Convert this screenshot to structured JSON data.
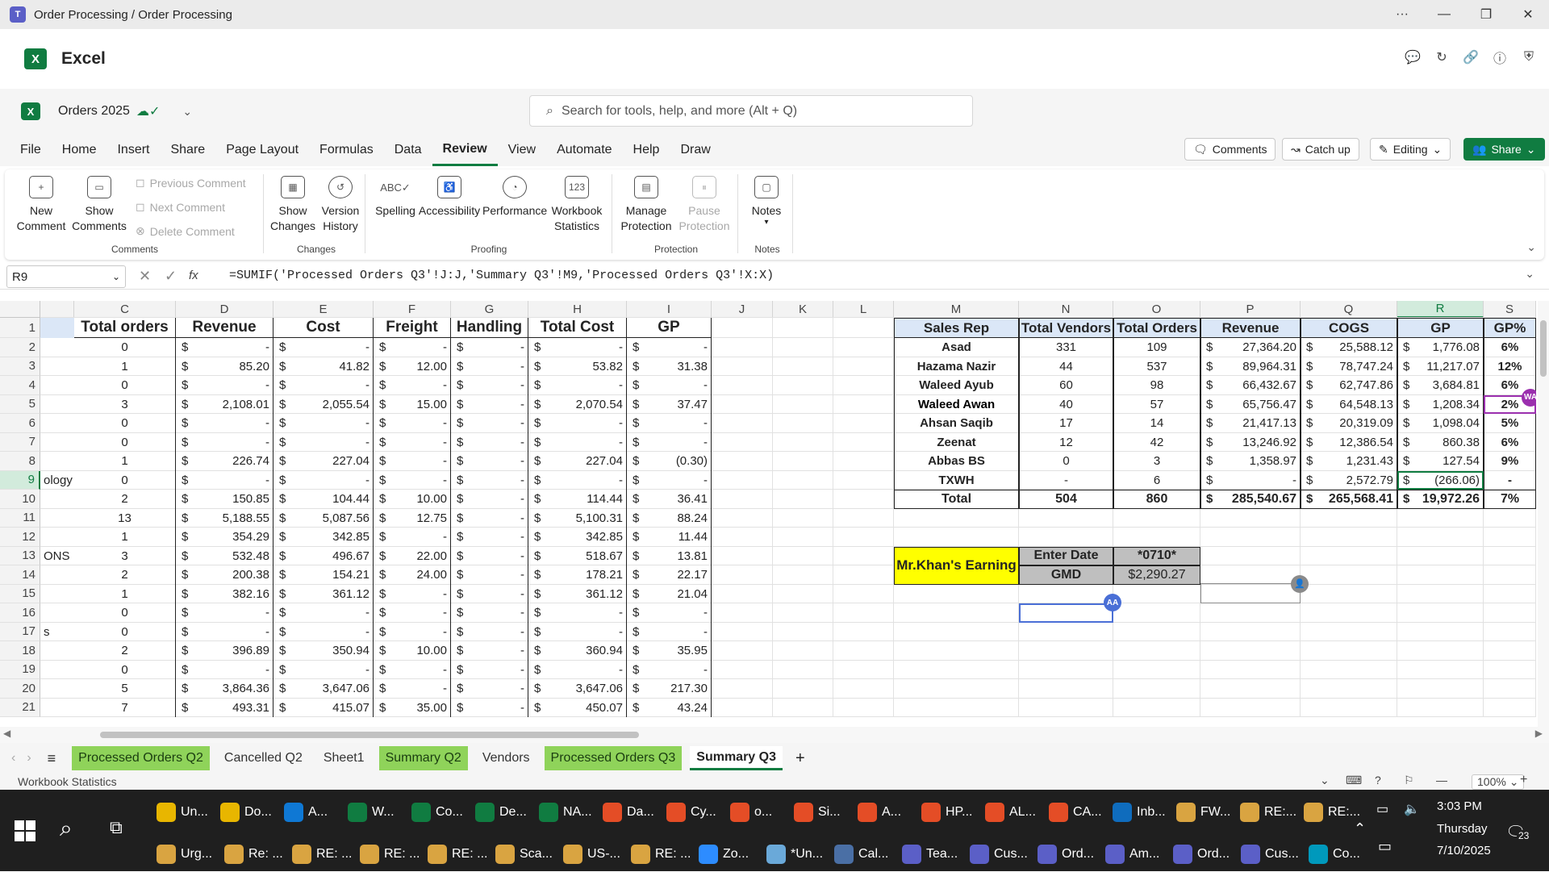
{
  "window": {
    "title": "Order Processing / Order Processing"
  },
  "app": {
    "name": "Excel",
    "logo": "X"
  },
  "doc": {
    "name": "Orders 2025",
    "saved_icon": "cloud-check-icon"
  },
  "search": {
    "placeholder": "Search for tools, help, and more (Alt + Q)"
  },
  "tabs": [
    "File",
    "Home",
    "Insert",
    "Share",
    "Page Layout",
    "Formulas",
    "Data",
    "Review",
    "View",
    "Automate",
    "Help",
    "Draw"
  ],
  "active_tab": "Review",
  "header_buttons": {
    "comments": "Comments",
    "catchup": "Catch up",
    "editing": "Editing",
    "share": "Share"
  },
  "ribbon": {
    "comments": {
      "label": "Comments",
      "new": [
        "New",
        "Comment"
      ],
      "show": [
        "Show",
        "Comments"
      ],
      "prev": "Previous Comment",
      "next": "Next Comment",
      "delete": "Delete Comment"
    },
    "changes": {
      "label": "Changes",
      "show": [
        "Show",
        "Changes"
      ],
      "version": [
        "Version",
        "History"
      ]
    },
    "proofing": {
      "label": "Proofing",
      "spelling": "Spelling",
      "accessibility": "Accessibility",
      "performance": "Performance",
      "stats": [
        "Workbook",
        "Statistics"
      ]
    },
    "protection": {
      "label": "Protection",
      "manage": [
        "Manage",
        "Protection"
      ],
      "pause": [
        "Pause",
        "Protection"
      ]
    },
    "notes": {
      "label": "Notes",
      "notes": "Notes"
    }
  },
  "formula_bar": {
    "name_box": "R9",
    "fx": "fx",
    "formula": "=SUMIF('Processed Orders Q3'!J:J,'Summary Q3'!M9,'Processed Orders Q3'!X:X)"
  },
  "columns": [
    "C",
    "D",
    "E",
    "F",
    "G",
    "H",
    "I",
    "J",
    "K",
    "L",
    "M",
    "N",
    "O",
    "P",
    "Q",
    "R",
    "S"
  ],
  "rows": [
    "1",
    "2",
    "3",
    "4",
    "5",
    "6",
    "7",
    "8",
    "9",
    "10",
    "11",
    "12",
    "13",
    "14",
    "15",
    "16",
    "17",
    "18",
    "19",
    "20",
    "21"
  ],
  "left_table": {
    "headers": [
      "Total orders",
      "Revenue",
      "Cost",
      "Freight",
      "Handling",
      "Total Cost",
      "GP"
    ],
    "b_fragments": {
      "9": "ology",
      "13": "ONS",
      "17": "s"
    },
    "rows": [
      [
        "0",
        "-",
        "-",
        "-",
        "-",
        "-",
        "-"
      ],
      [
        "1",
        "85.20",
        "41.82",
        "12.00",
        "-",
        "53.82",
        "31.38"
      ],
      [
        "0",
        "-",
        "-",
        "-",
        "-",
        "-",
        "-"
      ],
      [
        "3",
        "2,108.01",
        "2,055.54",
        "15.00",
        "-",
        "2,070.54",
        "37.47"
      ],
      [
        "0",
        "-",
        "-",
        "-",
        "-",
        "-",
        "-"
      ],
      [
        "0",
        "-",
        "-",
        "-",
        "-",
        "-",
        "-"
      ],
      [
        "1",
        "226.74",
        "227.04",
        "-",
        "-",
        "227.04",
        "(0.30)"
      ],
      [
        "0",
        "-",
        "-",
        "-",
        "-",
        "-",
        "-"
      ],
      [
        "2",
        "150.85",
        "104.44",
        "10.00",
        "-",
        "114.44",
        "36.41"
      ],
      [
        "13",
        "5,188.55",
        "5,087.56",
        "12.75",
        "-",
        "5,100.31",
        "88.24"
      ],
      [
        "1",
        "354.29",
        "342.85",
        "-",
        "-",
        "342.85",
        "11.44"
      ],
      [
        "3",
        "532.48",
        "496.67",
        "22.00",
        "-",
        "518.67",
        "13.81"
      ],
      [
        "2",
        "200.38",
        "154.21",
        "24.00",
        "-",
        "178.21",
        "22.17"
      ],
      [
        "1",
        "382.16",
        "361.12",
        "-",
        "-",
        "361.12",
        "21.04"
      ],
      [
        "0",
        "-",
        "-",
        "-",
        "-",
        "-",
        "-"
      ],
      [
        "0",
        "-",
        "-",
        "-",
        "-",
        "-",
        "-"
      ],
      [
        "2",
        "396.89",
        "350.94",
        "10.00",
        "-",
        "360.94",
        "35.95"
      ],
      [
        "0",
        "-",
        "-",
        "-",
        "-",
        "-",
        "-"
      ],
      [
        "5",
        "3,864.36",
        "3,647.06",
        "-",
        "-",
        "3,647.06",
        "217.30"
      ],
      [
        "7",
        "493.31",
        "415.07",
        "35.00",
        "-",
        "450.07",
        "43.24"
      ]
    ]
  },
  "right_table": {
    "headers": [
      "Sales Rep",
      "Total Vendors",
      "Total Orders",
      "Revenue",
      "COGS",
      "GP",
      "GP%"
    ],
    "rows": [
      [
        "Asad",
        "331",
        "109",
        "27,364.20",
        "25,588.12",
        "1,776.08",
        "6%"
      ],
      [
        "Hazama Nazir",
        "44",
        "537",
        "89,964.31",
        "78,747.24",
        "11,217.07",
        "12%"
      ],
      [
        "Waleed Ayub",
        "60",
        "98",
        "66,432.67",
        "62,747.86",
        "3,684.81",
        "6%"
      ],
      [
        "Waleed Awan",
        "40",
        "57",
        "65,756.47",
        "64,548.13",
        "1,208.34",
        "2%"
      ],
      [
        "Ahsan Saqib",
        "17",
        "14",
        "21,417.13",
        "20,319.09",
        "1,098.04",
        "5%"
      ],
      [
        "Zeenat",
        "12",
        "42",
        "13,246.92",
        "12,386.54",
        "860.38",
        "6%"
      ],
      [
        "Abbas BS",
        "0",
        "3",
        "1,358.97",
        "1,231.43",
        "127.54",
        "9%"
      ],
      [
        "TXWH",
        "-",
        "6",
        "-",
        "2,572.79",
        "(266.06)",
        "-"
      ]
    ],
    "total": [
      "Total",
      "504",
      "860",
      "285,540.67",
      "265,568.41",
      "19,972.26",
      "7%"
    ]
  },
  "currency": "$",
  "earning": {
    "label": "Mr.Khan's Earning",
    "enter_date": "Enter Date",
    "date_value": "*0710*",
    "gmd": "GMD",
    "gmd_value": "$2,290.27"
  },
  "collab": {
    "aa": "AA",
    "wa": "WA"
  },
  "sheets": [
    "Processed Orders Q2",
    "Cancelled Q2",
    "Sheet1",
    "Summary Q2",
    "Vendors",
    "Processed Orders Q3",
    "Summary Q3"
  ],
  "green_sheets": [
    0,
    3,
    5
  ],
  "active_sheet": 6,
  "status": {
    "left": "Workbook Statistics",
    "zoom": "100%"
  },
  "taskbar": {
    "row1": [
      "Un...",
      "Do...",
      "A...",
      "W...",
      "Co...",
      "De...",
      "NA...",
      "Da...",
      "Cy...",
      "o...",
      "Si...",
      "A...",
      "HP...",
      "AL...",
      "CA...",
      "Inb...",
      "FW...",
      "RE:...",
      "RE:..."
    ],
    "row2": [
      "Urg...",
      "Re: ...",
      "RE: ...",
      "RE: ...",
      "RE: ...",
      "Sca...",
      "US-...",
      "RE: ...",
      "Zo...",
      "*Un...",
      "Cal...",
      "Tea...",
      "Cus...",
      "Ord...",
      "Am...",
      "Ord...",
      "Cus...",
      "Co..."
    ],
    "time": "3:03 PM",
    "day": "Thursday",
    "date": "7/10/2025",
    "notif": "23"
  }
}
